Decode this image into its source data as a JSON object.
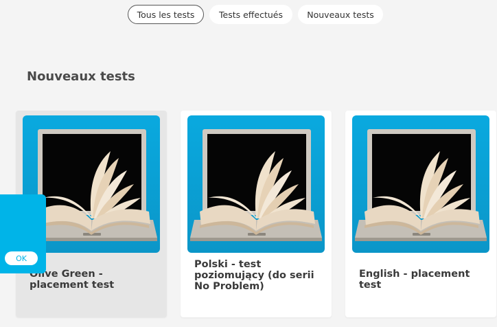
{
  "tabs": [
    {
      "label": "Tous les tests",
      "active": true
    },
    {
      "label": "Tests effectués",
      "active": false
    },
    {
      "label": "Nouveaux tests",
      "active": false
    }
  ],
  "section": {
    "title": "Nouveaux tests"
  },
  "cards": [
    {
      "title": "Olive Green - placement test",
      "image": "laptop-open-book-image"
    },
    {
      "title": "Polski - test poziomujący (do serii No Problem)",
      "image": "laptop-open-book-image"
    },
    {
      "title": "English - placement test",
      "image": "laptop-open-book-image"
    }
  ],
  "cookie_banner": {
    "ok_label": "OK"
  },
  "colors": {
    "accent": "#00b4e8",
    "background": "#f4f4f4",
    "card": "#ffffff",
    "card_hover": "#e6e6e6"
  }
}
